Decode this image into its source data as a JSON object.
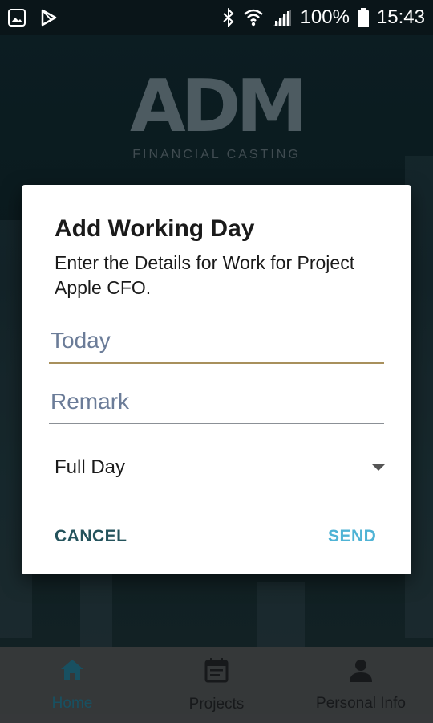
{
  "status_bar": {
    "battery": "100%",
    "time": "15:43",
    "icons": [
      "image-icon",
      "play-store-icon",
      "bluetooth-icon",
      "wifi-icon",
      "signal-icon",
      "battery-icon"
    ]
  },
  "app": {
    "logo_text": "ADM",
    "logo_subtitle": "FINANCIAL CASTING"
  },
  "dialog": {
    "title": "Add Working Day",
    "message": "Enter the Details for Work for Project Apple CFO.",
    "date_field": {
      "placeholder": "Today"
    },
    "remark_field": {
      "placeholder": "Remark"
    },
    "day_type": {
      "selected": "Full Day"
    },
    "cancel_label": "CANCEL",
    "send_label": "SEND"
  },
  "bottom_nav": {
    "items": [
      {
        "label": "Home",
        "icon": "home-icon",
        "active": true
      },
      {
        "label": "Projects",
        "icon": "calendar-icon",
        "active": false
      },
      {
        "label": "Personal Info",
        "icon": "person-icon",
        "active": false
      }
    ]
  },
  "colors": {
    "accent_underline": "#a8905c",
    "send_button": "#4fb3d5",
    "cancel_button": "#24535c",
    "nav_active": "#1d5f73"
  }
}
